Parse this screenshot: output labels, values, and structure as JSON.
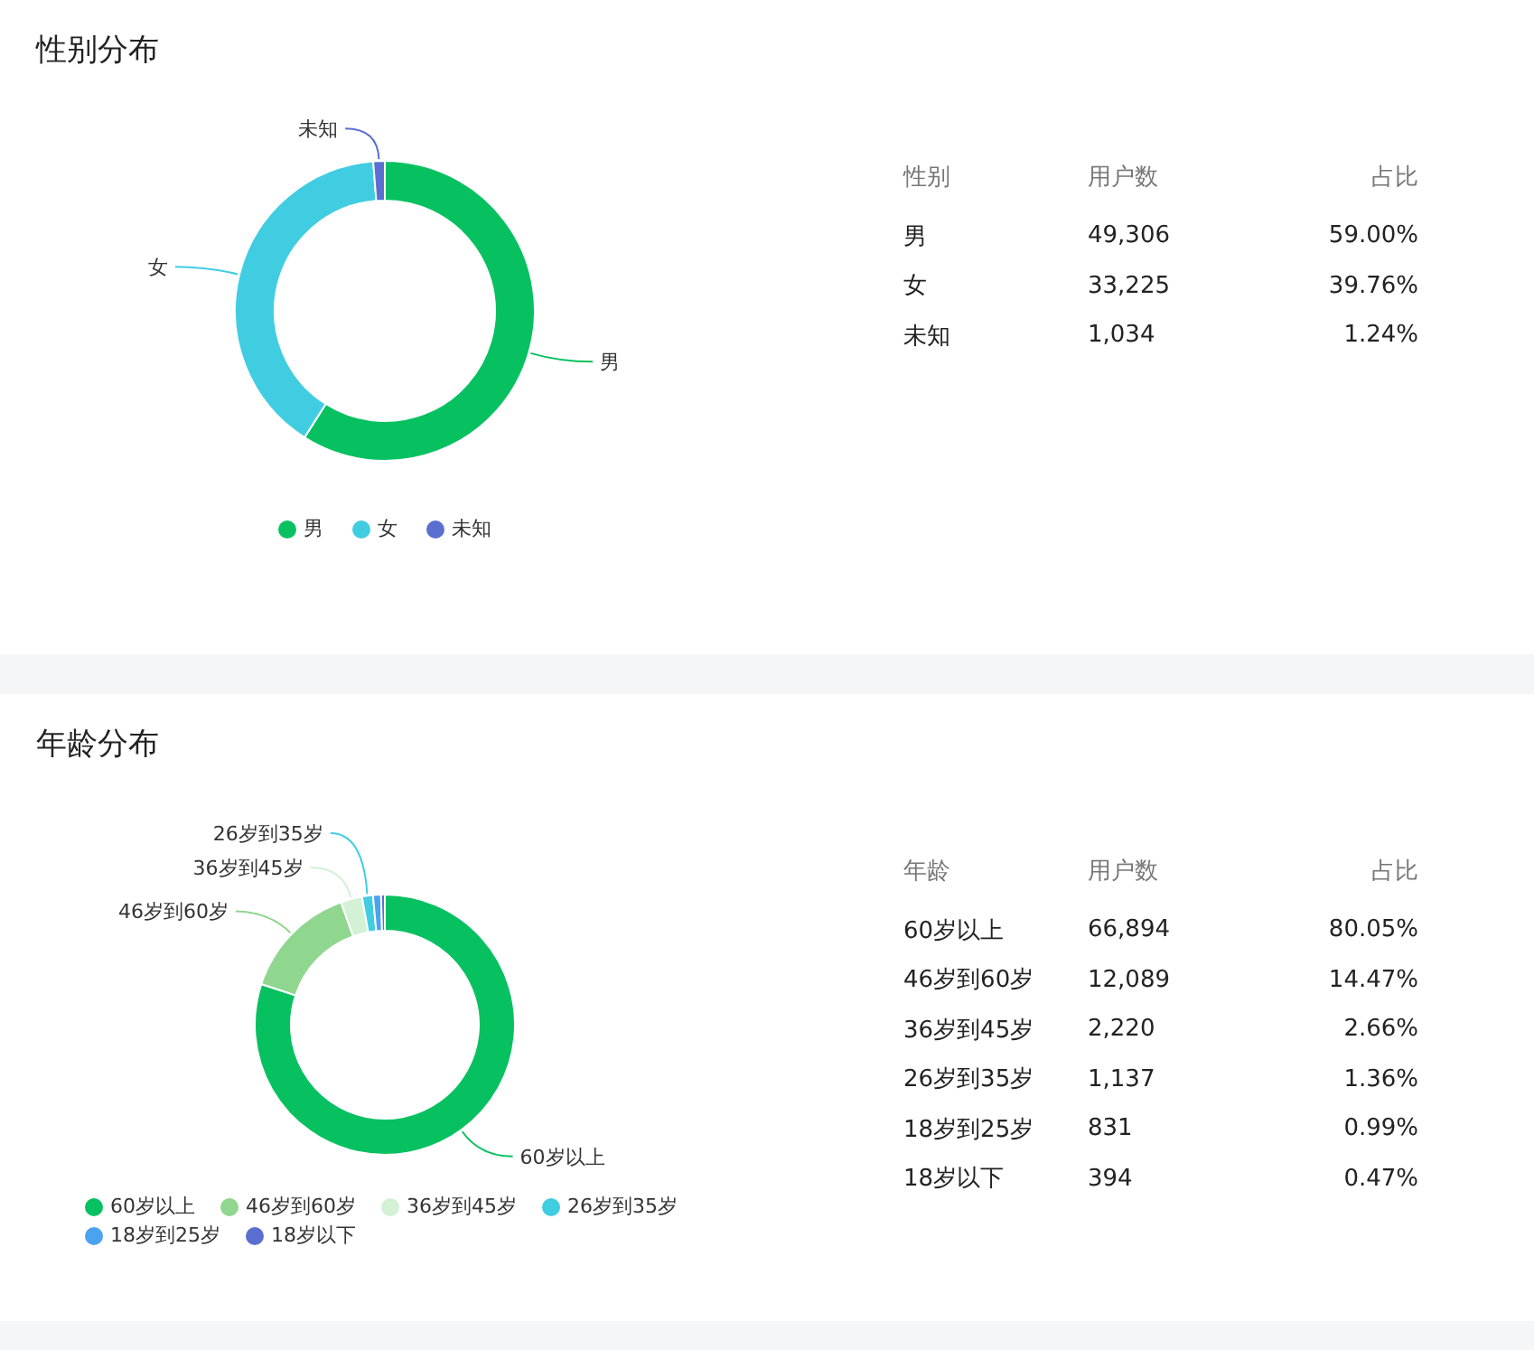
{
  "sections": [
    {
      "title": "性别分布",
      "chart_data": {
        "type": "donut",
        "categories": [
          "男",
          "女",
          "未知"
        ],
        "values": [
          59.0,
          39.76,
          1.24
        ],
        "colors": [
          "#07c160",
          "#40cde2",
          "#5b6fd0"
        ]
      },
      "table": {
        "columns": [
          "性别",
          "用户数",
          "占比"
        ],
        "rows": [
          [
            "男",
            "49,306",
            "59.00%"
          ],
          [
            "女",
            "33,225",
            "39.76%"
          ],
          [
            "未知",
            "1,034",
            "1.24%"
          ]
        ]
      }
    },
    {
      "title": "年龄分布",
      "chart_data": {
        "type": "donut",
        "categories": [
          "60岁以上",
          "46岁到60岁",
          "36岁到45岁",
          "26岁到35岁",
          "18岁到25岁",
          "18岁以下"
        ],
        "values": [
          80.05,
          14.47,
          2.66,
          1.36,
          0.99,
          0.47
        ],
        "colors": [
          "#07c160",
          "#8fd68f",
          "#d2f1d5",
          "#40cde2",
          "#4aa3ef",
          "#5b6fd0"
        ]
      },
      "table": {
        "columns": [
          "年龄",
          "用户数",
          "占比"
        ],
        "rows": [
          [
            "60岁以上",
            "66,894",
            "80.05%"
          ],
          [
            "46岁到60岁",
            "12,089",
            "14.47%"
          ],
          [
            "36岁到45岁",
            "2,220",
            "2.66%"
          ],
          [
            "26岁到35岁",
            "1,137",
            "1.36%"
          ],
          [
            "18岁到25岁",
            "831",
            "0.99%"
          ],
          [
            "18岁以下",
            "394",
            "0.47%"
          ]
        ]
      }
    }
  ]
}
